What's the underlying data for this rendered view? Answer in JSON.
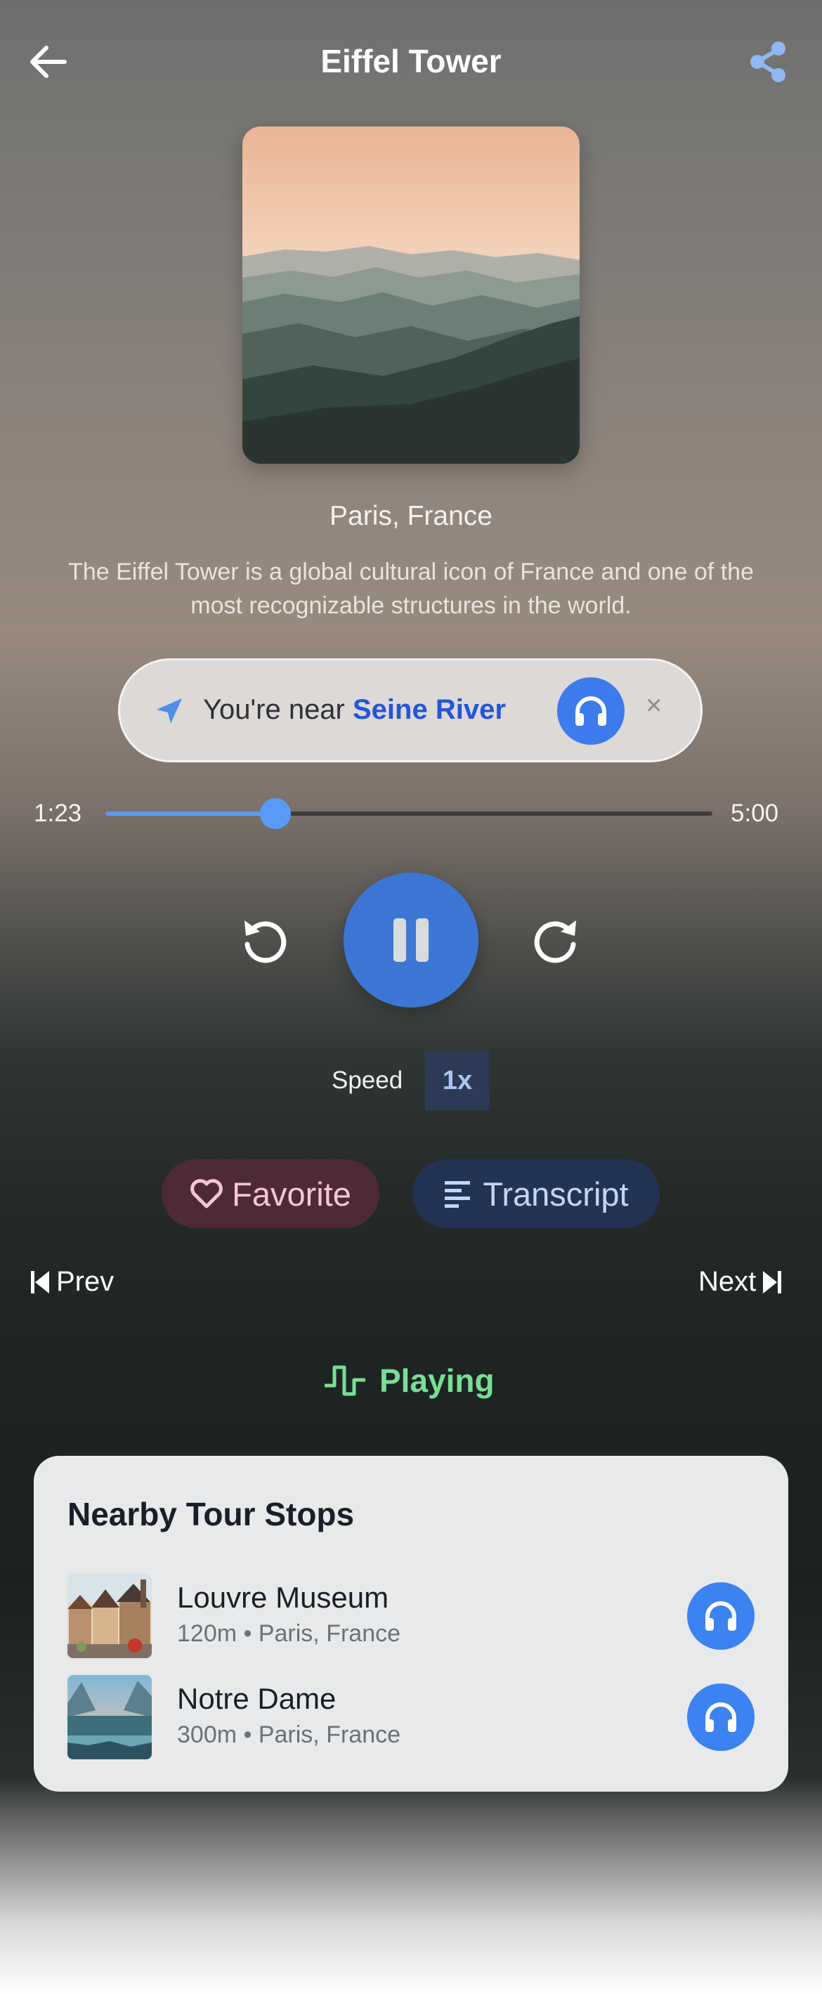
{
  "header": {
    "title": "Eiffel Tower",
    "back_icon": "arrow-left-icon",
    "share_icon": "share-icon"
  },
  "artwork": {
    "description_icon": "mountain-landscape-image"
  },
  "location": "Paris, France",
  "description": "The Eiffel Tower is a global cultural icon of France and one of the most recognizable structures in the world.",
  "proximity": {
    "prefix": "You're near ",
    "place": "Seine River",
    "dismiss": "×"
  },
  "progress": {
    "current": "1:23",
    "total": "5:00",
    "fraction": 0.28
  },
  "speed": {
    "label": "Speed",
    "value": "1x"
  },
  "actions": {
    "favorite": "Favorite",
    "transcript": "Transcript"
  },
  "nav": {
    "prev": "Prev",
    "next": "Next"
  },
  "status": "Playing",
  "nearby": {
    "title": "Nearby Tour Stops",
    "items": [
      {
        "name": "Louvre Museum",
        "meta": "120m • Paris, France"
      },
      {
        "name": "Notre Dame",
        "meta": "300m • Paris, France"
      }
    ]
  },
  "colors": {
    "accent": "#3c7bec",
    "playing": "#78de96",
    "link": "#2355d8"
  }
}
